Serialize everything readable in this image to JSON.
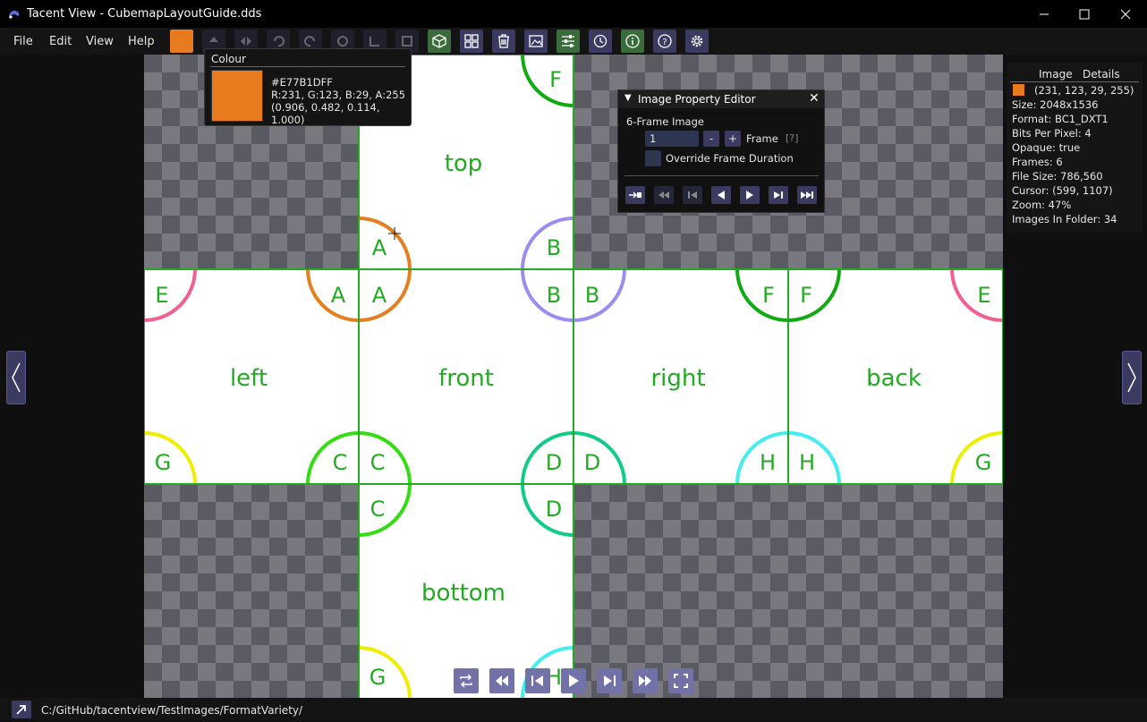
{
  "window": {
    "title": "Tacent View - CubemapLayoutGuide.dds",
    "controls": [
      "minimize",
      "maximize",
      "close"
    ]
  },
  "menu": [
    "File",
    "Edit",
    "View",
    "Help"
  ],
  "toolbar": {
    "colour_swatch": "#E77B1D",
    "icons": [
      "colour-swatch-icon",
      "flip-vertical-icon",
      "flip-horizontal-icon",
      "rotate-ccw-icon",
      "rotate-cw-icon",
      "crop-icon",
      "resize-icon",
      "canvas-icon",
      "cubemap-icon",
      "contact-sheet-icon",
      "delete-icon",
      "save-image-icon",
      "preferences-sliders-icon",
      "refresh-icon",
      "info-icon",
      "help-icon",
      "settings-icon"
    ]
  },
  "colour_popup": {
    "title": "Colour",
    "hex": "#E77B1DFF",
    "rgba": "R:231, G:123, B:29, A:255",
    "normalized": "(0.906, 0.482, 0.114, 1.000)",
    "swatch": "#E77B1D"
  },
  "image_property_editor": {
    "title": "Image Property Editor",
    "frame_label": "6-Frame Image",
    "frame_value": "1",
    "minus": "-",
    "plus": "+",
    "frame_text": "Frame",
    "help": "[?]",
    "override_label": "Override Frame Duration"
  },
  "details": {
    "tabs": [
      "Image",
      "Details"
    ],
    "colour_text": "(231, 123, 29, 255)",
    "rows": [
      "Size: 2048x1536",
      "Format: BC1_DXT1",
      "Bits Per Pixel: 4",
      "Opaque: true",
      "Frames: 6",
      "File Size: 786,560",
      "Cursor: (599, 1107)",
      "Zoom: 47%",
      "Images In Folder: 34"
    ]
  },
  "cubemap": {
    "faces": {
      "top": "top",
      "left": "left",
      "front": "front",
      "right": "right",
      "back": "back",
      "bottom": "bottom"
    },
    "letters": [
      "A",
      "B",
      "C",
      "D",
      "E",
      "F",
      "G",
      "H"
    ],
    "colors": {
      "A": "#e67e22",
      "B": "#9b8cf0",
      "C": "#33dd11",
      "D": "#11cc88",
      "E": "#f06090",
      "F": "#11aa11",
      "G": "#eeee00",
      "H": "#44eeee",
      "text": "#22aa22"
    }
  },
  "status": {
    "path": "C:/GitHub/tacentview/TestImages/FormatVariety/"
  }
}
